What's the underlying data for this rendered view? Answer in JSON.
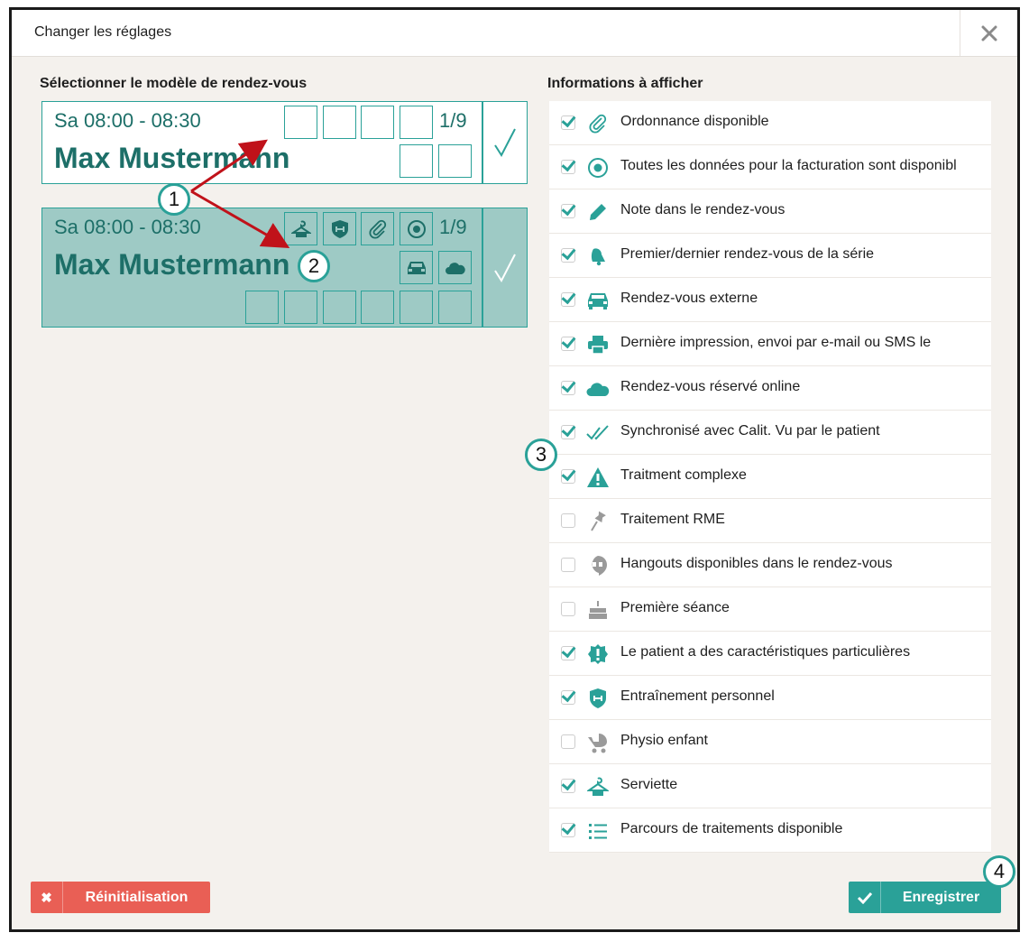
{
  "dialog": {
    "title": "Changer les réglages",
    "close_icon": "close-icon"
  },
  "left": {
    "title": "Sélectionner le modèle de rendez-vous",
    "templates": [
      {
        "time": "Sa 08:00 - 08:30",
        "name": "Max Mustermann",
        "count": "1/9",
        "selected": false
      },
      {
        "time": "Sa 08:00 - 08:30",
        "name": "Max Mustermann",
        "count": "1/9",
        "selected": true,
        "icons": [
          "hanger-icon",
          "shield-dumbbell-icon",
          "paperclip-icon",
          "target-icon",
          "car-icon",
          "cloud-icon"
        ]
      }
    ]
  },
  "right": {
    "title": "Informations à afficher",
    "items": [
      {
        "label": "Ordonnance disponible",
        "checked": true,
        "icon": "paperclip-icon"
      },
      {
        "label": "Toutes les données pour la facturation sont disponibl",
        "checked": true,
        "icon": "target-icon"
      },
      {
        "label": "Note dans le rendez-vous",
        "checked": true,
        "icon": "pencil-icon"
      },
      {
        "label": "Premier/dernier rendez-vous de la série",
        "checked": true,
        "icon": "bell-icon"
      },
      {
        "label": "Rendez-vous externe",
        "checked": true,
        "icon": "car-icon"
      },
      {
        "label": "Dernière impression, envoi par e-mail ou SMS le",
        "checked": true,
        "icon": "printer-icon"
      },
      {
        "label": "Rendez-vous réservé online",
        "checked": true,
        "icon": "cloud-icon"
      },
      {
        "label": "Synchronisé avec Calit. Vu par le patient",
        "checked": true,
        "icon": "double-check-icon"
      },
      {
        "label": "Traitment complexe",
        "checked": true,
        "icon": "warning-icon"
      },
      {
        "label": "Traitement RME",
        "checked": false,
        "icon": "pin-icon"
      },
      {
        "label": "Hangouts disponibles dans le rendez-vous",
        "checked": false,
        "icon": "hangouts-icon"
      },
      {
        "label": "Première séance",
        "checked": false,
        "icon": "cake-icon"
      },
      {
        "label": "Le patient a des caractéristiques particulières",
        "checked": true,
        "icon": "alert-badge-icon"
      },
      {
        "label": "Entraînement personnel",
        "checked": true,
        "icon": "shield-dumbbell-icon"
      },
      {
        "label": "Physio enfant",
        "checked": false,
        "icon": "stroller-icon"
      },
      {
        "label": "Serviette",
        "checked": true,
        "icon": "hanger-icon"
      },
      {
        "label": "Parcours de traitements disponible",
        "checked": true,
        "icon": "list-icon"
      }
    ]
  },
  "buttons": {
    "reset_label": "Réinitialisation",
    "save_label": "Enregistrer"
  },
  "annotations": [
    "1",
    "2",
    "3",
    "4"
  ],
  "colors": {
    "accent": "#2aa198",
    "danger": "#e95f55",
    "arrow": "#c0121a",
    "selected_card": "#9ecac5"
  }
}
